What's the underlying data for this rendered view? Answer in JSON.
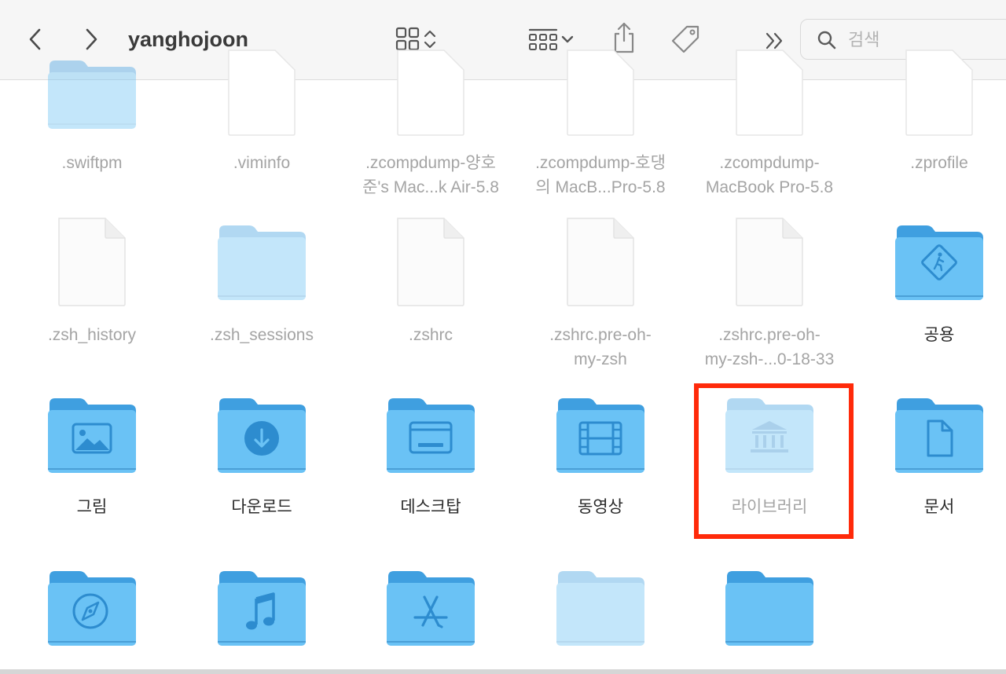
{
  "toolbar": {
    "title": "yanghojoon",
    "back_icon": "chevron-left-icon",
    "forward_icon": "chevron-right-icon",
    "view_icon": "grid-view-icon",
    "group_icon": "group-by-icon",
    "share_icon": "share-icon",
    "tag_icon": "tag-icon",
    "more_icon": "double-chevron-icon",
    "search": {
      "placeholder": "검색",
      "value": ""
    }
  },
  "files": [
    {
      "name": ".swiftpm",
      "type": "folder",
      "hidden": true
    },
    {
      "name": ".viminfo",
      "type": "doc",
      "hidden": true
    },
    {
      "name": ".zcompdump-양호\n준's Mac...k Air-5.8",
      "type": "doc",
      "hidden": true
    },
    {
      "name": ".zcompdump-호댕\n의 MacB...Pro-5.8",
      "type": "doc",
      "hidden": true
    },
    {
      "name": ".zcompdump-\nMacBook Pro-5.8",
      "type": "doc",
      "hidden": true
    },
    {
      "name": ".zprofile",
      "type": "doc",
      "hidden": true
    },
    {
      "name": ".zsh_history",
      "type": "doc",
      "hidden": true
    },
    {
      "name": ".zsh_sessions",
      "type": "folder",
      "hidden": true
    },
    {
      "name": ".zshrc",
      "type": "doc",
      "hidden": true
    },
    {
      "name": ".zshrc.pre-oh-\nmy-zsh",
      "type": "doc",
      "hidden": true
    },
    {
      "name": ".zshrc.pre-oh-\nmy-zsh-...0-18-33",
      "type": "doc",
      "hidden": true
    },
    {
      "name": "공용",
      "type": "folder",
      "glyph": "public",
      "hidden": false
    },
    {
      "name": "그림",
      "type": "folder",
      "glyph": "picture",
      "hidden": false
    },
    {
      "name": "다운로드",
      "type": "folder",
      "glyph": "download",
      "hidden": false
    },
    {
      "name": "데스크탑",
      "type": "folder",
      "glyph": "desktop",
      "hidden": false
    },
    {
      "name": "동영상",
      "type": "folder",
      "glyph": "movie",
      "hidden": false
    },
    {
      "name": "라이브러리",
      "type": "folder",
      "glyph": "library",
      "hidden": true
    },
    {
      "name": "문서",
      "type": "folder",
      "glyph": "document",
      "hidden": false
    },
    {
      "name": "",
      "type": "folder",
      "glyph": "safari",
      "hidden": false
    },
    {
      "name": "",
      "type": "folder",
      "glyph": "music",
      "hidden": false
    },
    {
      "name": "",
      "type": "folder",
      "glyph": "appstore",
      "hidden": false
    },
    {
      "name": "",
      "type": "folder",
      "glyph": "",
      "hidden": true
    },
    {
      "name": "",
      "type": "folder",
      "glyph": "",
      "hidden": false
    }
  ],
  "colors": {
    "folder_back": "#3f9fe0",
    "folder_front": "#6ac2f5",
    "folder_glyph": "#2d8ccf",
    "highlight": "#ff2a0a"
  }
}
